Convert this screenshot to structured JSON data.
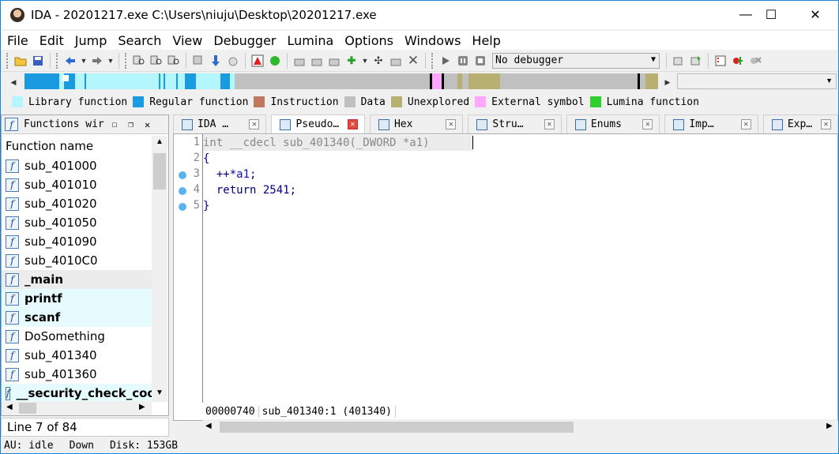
{
  "window": {
    "title": "IDA - 20201217.exe C:\\Users\\niuju\\Desktop\\20201217.exe",
    "minimize": "—",
    "maximize": "☐",
    "close": "✕"
  },
  "menubar": [
    "File",
    "Edit",
    "Jump",
    "Search",
    "View",
    "Debugger",
    "Lumina",
    "Options",
    "Windows",
    "Help"
  ],
  "toolbar": {
    "debugger_select": "No debugger",
    "icons": [
      "open-icon",
      "save-icon",
      "back-icon",
      "forward-icon",
      "assemble-icon",
      "run-icon",
      "stop-icon"
    ]
  },
  "legend": [
    {
      "label": "Library function",
      "color": "#b3f6fd"
    },
    {
      "label": "Regular function",
      "color": "#1a9ae0"
    },
    {
      "label": "Instruction",
      "color": "#c07860"
    },
    {
      "label": "Data",
      "color": "#c0c0c0"
    },
    {
      "label": "Unexplored",
      "color": "#b8b070"
    },
    {
      "label": "External symbol",
      "color": "#ffa6ff"
    },
    {
      "label": "Lumina function",
      "color": "#30d030"
    }
  ],
  "functions_panel": {
    "title": "Functions wir",
    "column_header": "Function name",
    "items": [
      {
        "name": "sub_401000",
        "kind": "regular"
      },
      {
        "name": "sub_401010",
        "kind": "regular"
      },
      {
        "name": "sub_401020",
        "kind": "regular"
      },
      {
        "name": "sub_401050",
        "kind": "regular"
      },
      {
        "name": "sub_401090",
        "kind": "regular"
      },
      {
        "name": "sub_4010C0",
        "kind": "regular"
      },
      {
        "name": "_main",
        "kind": "current"
      },
      {
        "name": "printf",
        "kind": "library"
      },
      {
        "name": "scanf",
        "kind": "library"
      },
      {
        "name": "DoSomething",
        "kind": "regular"
      },
      {
        "name": "sub_401340",
        "kind": "regular"
      },
      {
        "name": "sub_401360",
        "kind": "regular"
      },
      {
        "name": "__security_check_coo",
        "kind": "library"
      }
    ],
    "status": "Line 7 of 84"
  },
  "tabs": [
    {
      "label": "IDA …"
    },
    {
      "label": "Pseudo…"
    },
    {
      "label": "Hex"
    },
    {
      "label": "Stru…"
    },
    {
      "label": "Enums"
    },
    {
      "label": "Imp…"
    },
    {
      "label": "Exp…"
    }
  ],
  "editor": {
    "line_numbers": [
      "1",
      "2",
      "3",
      "4",
      "5"
    ],
    "lines": {
      "l1": "int __cdecl sub_401340(_DWORD *a1)",
      "l2": "{",
      "l3a": "  ++*",
      "l3b": "a1",
      "l3c": ";",
      "l4a": "  return ",
      "l4b": "2541",
      "l4c": ";",
      "l5": "}"
    },
    "status_addr": "00000740",
    "status_loc": "sub_401340:1 (401340)"
  },
  "statusbar": {
    "au": "AU:  idle",
    "direction": "Down",
    "disk": "Disk: 153GB"
  }
}
